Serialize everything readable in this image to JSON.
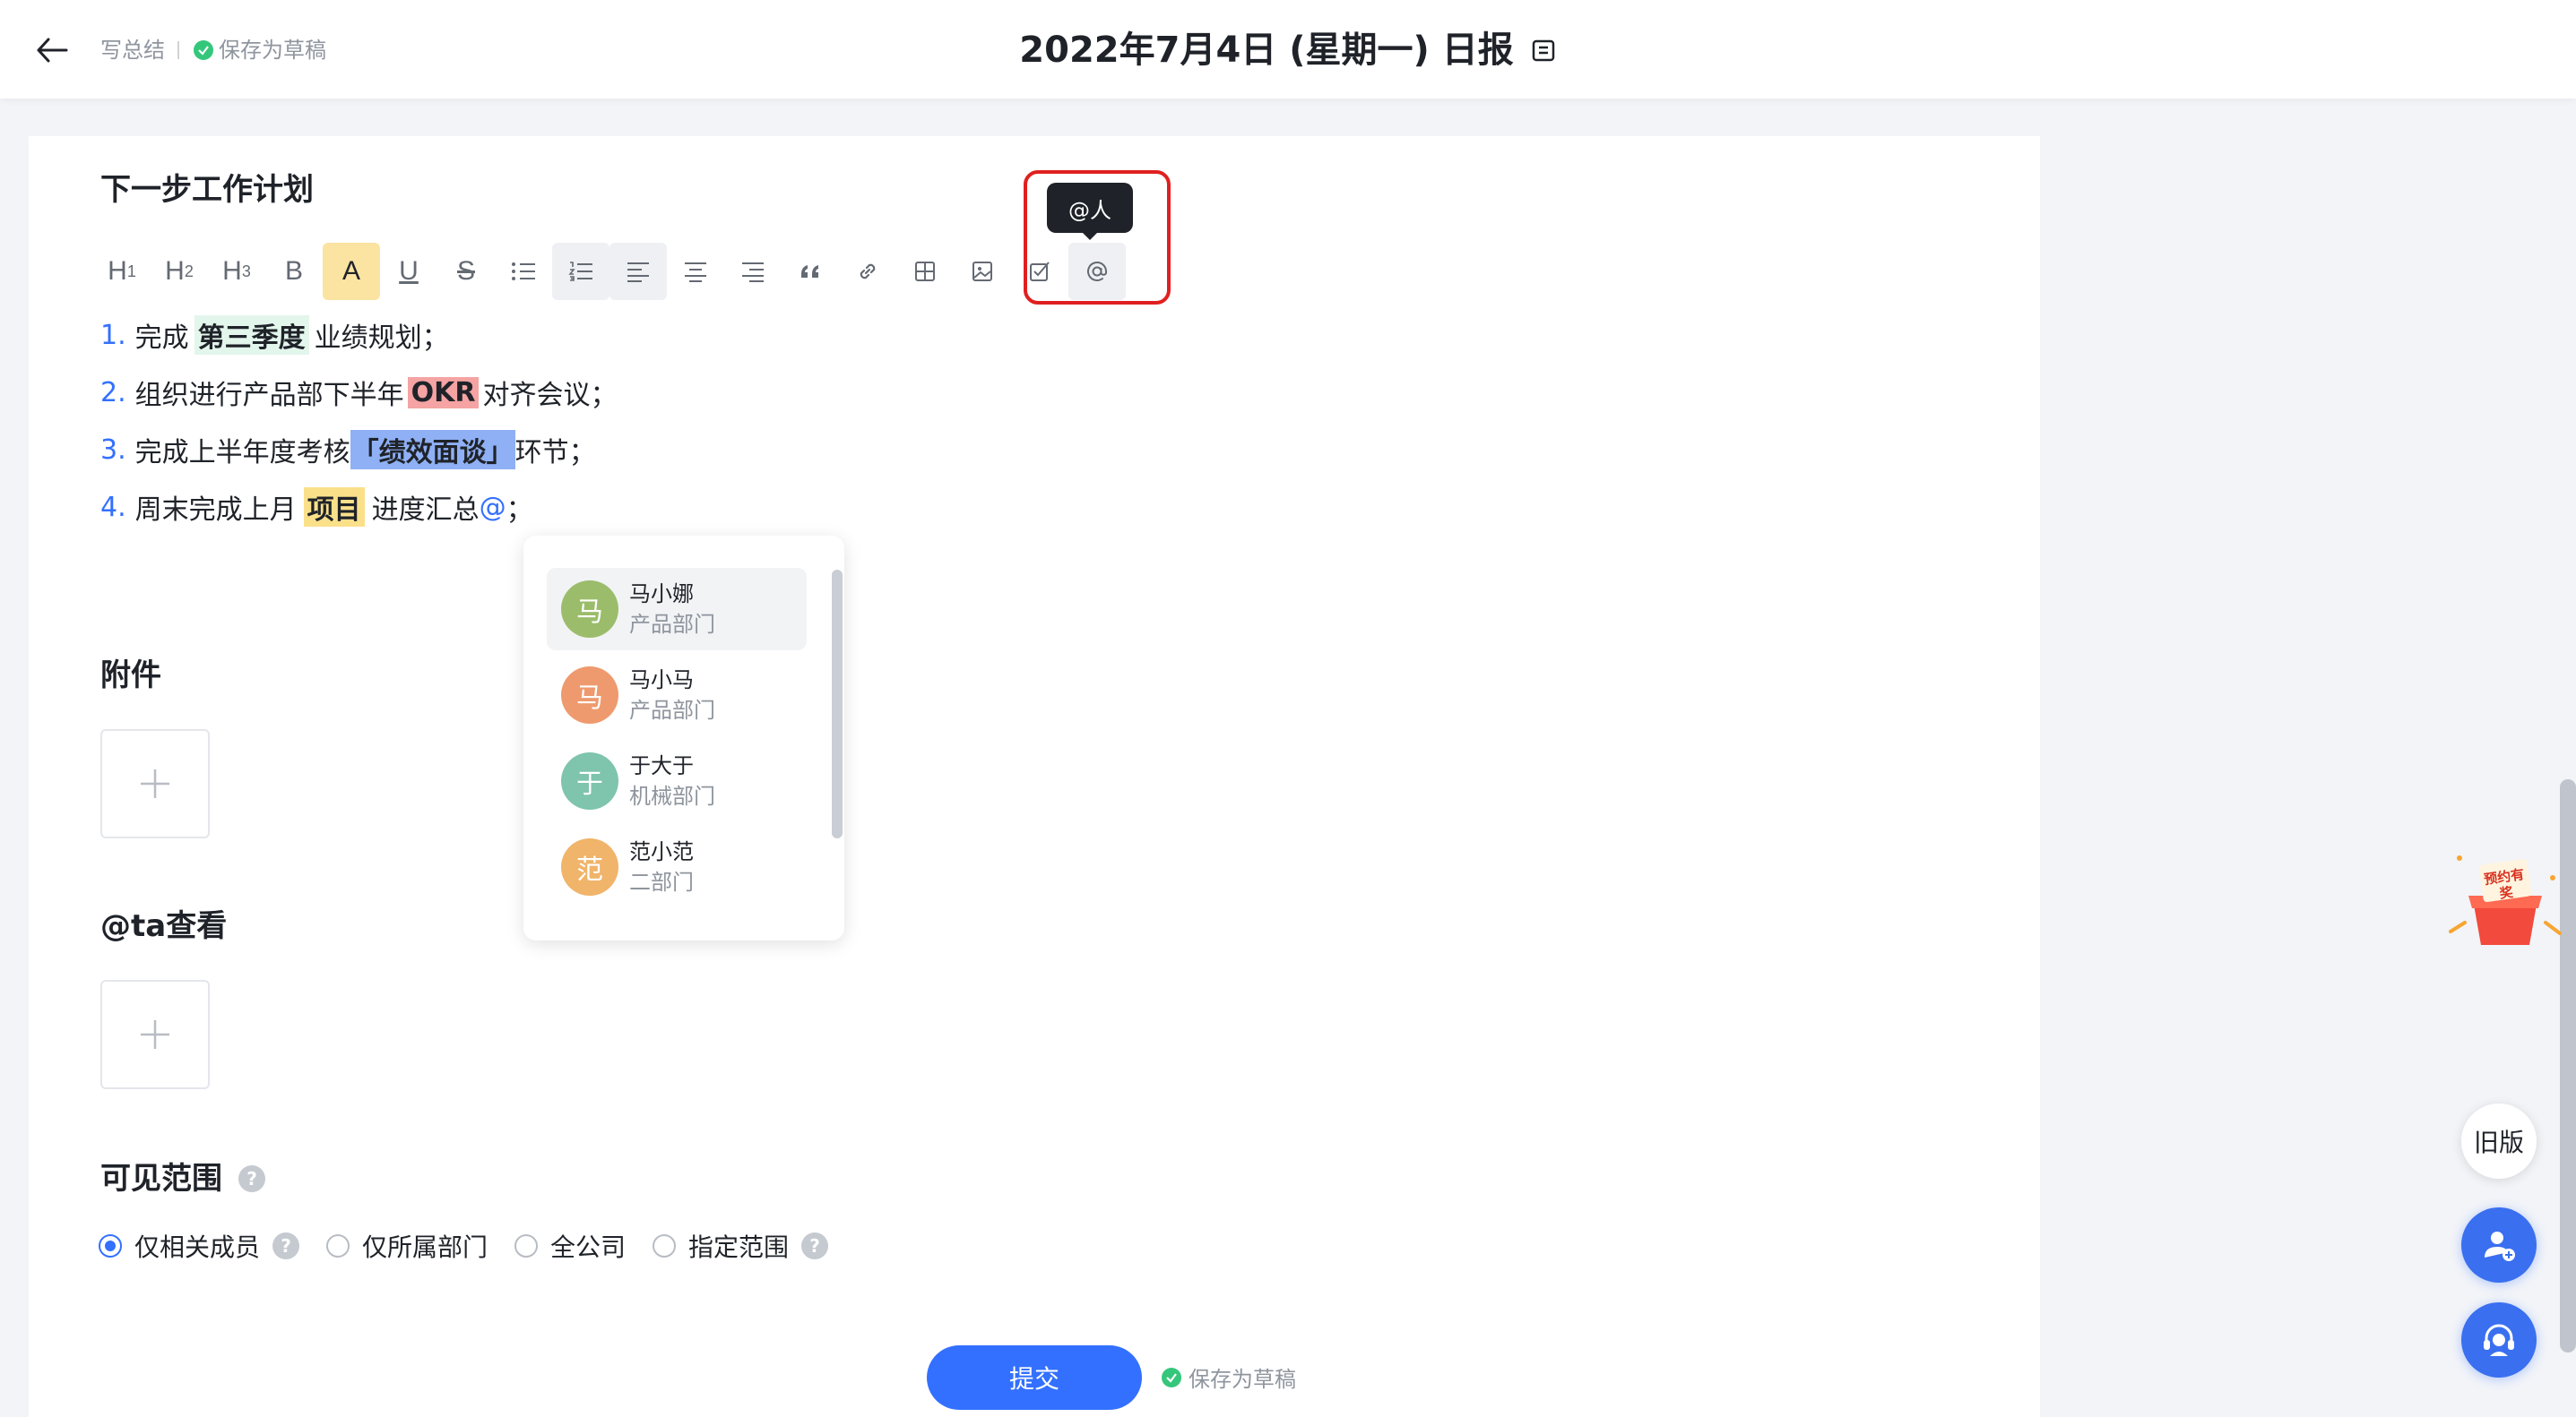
{
  "header": {
    "crumb_write": "写总结",
    "draft_status": "保存为草稿",
    "title": "2022年7月4日 (星期一) 日报"
  },
  "next_plan": {
    "title": "下一步工作计划",
    "tooltip": "@人",
    "toolbar": [
      "H1",
      "H2",
      "H3",
      "B",
      "A",
      "U",
      "S"
    ],
    "lines": [
      {
        "num": "1.",
        "pre": "完成",
        "hl": "第三季度",
        "post": "业绩规划；"
      },
      {
        "num": "2.",
        "pre": "组织进行产品部下半年",
        "hl": "OKR",
        "post": "对齐会议；"
      },
      {
        "num": "3.",
        "pre": "完成上半年度考核",
        "hl": "「绩效面谈」",
        "post": "环节；"
      },
      {
        "num": "4.",
        "pre": "周末完成上月",
        "hl": "项目",
        "post": "进度汇总",
        "at": "@",
        "end": "；"
      }
    ]
  },
  "mention_list": [
    {
      "avatar": "马",
      "name": "马小娜",
      "dept": "产品部门",
      "color": "#9bbd6b"
    },
    {
      "avatar": "马",
      "name": "马小马",
      "dept": "产品部门",
      "color": "#ee9a6e"
    },
    {
      "avatar": "于",
      "name": "于大于",
      "dept": "机械部门",
      "color": "#7fc4ad"
    },
    {
      "avatar": "范",
      "name": "范小范",
      "dept": "二部门",
      "color": "#f0b46a"
    }
  ],
  "attachments": {
    "title": "附件"
  },
  "at_view": {
    "title": "@ta查看"
  },
  "visibility": {
    "title": "可见范围",
    "options": [
      "仅相关成员",
      "仅所属部门",
      "全公司",
      "指定范围"
    ],
    "selected": "仅相关成员"
  },
  "footer": {
    "submit": "提交",
    "draft": "保存为草稿"
  },
  "side": {
    "old_version": "旧版",
    "gift_text": "预约有奖"
  },
  "colors": {
    "primary": "#3370ff",
    "success": "#34c77b",
    "highlight_box": "#e02020"
  }
}
